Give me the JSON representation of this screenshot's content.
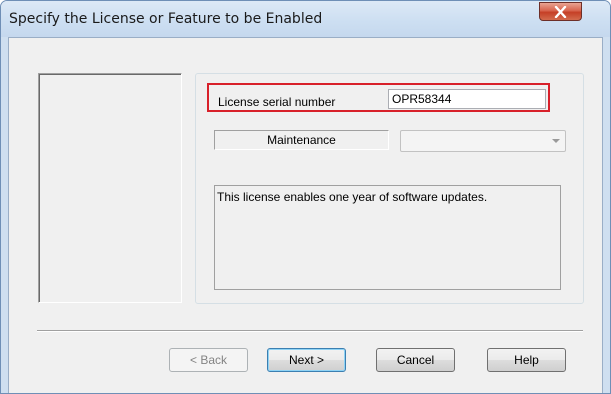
{
  "window": {
    "title": "Specify the License or Feature to be Enabled",
    "close_icon": "close-x-icon"
  },
  "license": {
    "serial_label": "License serial number",
    "serial_value": "OPR58344",
    "feature_name": "Maintenance",
    "feature_select_value": "",
    "description": "This license enables one year of software updates."
  },
  "buttons": {
    "back": "< Back",
    "next": "Next >",
    "cancel": "Cancel",
    "help": "Help"
  },
  "colors": {
    "highlight": "#d8202a",
    "close_button": "#c53f26"
  }
}
